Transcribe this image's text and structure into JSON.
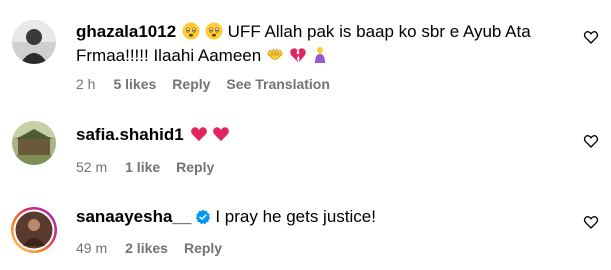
{
  "comments": [
    {
      "username": "ghazala1012",
      "text_line1": "UFF Allah pak is baap ko sbr e Ayub Ata",
      "text_line2": "Frmaa!!!!! Ilaahi Aameen",
      "time": "2 h",
      "likes": "5 likes",
      "reply": "Reply",
      "see_translation": "See Translation"
    },
    {
      "username": "safia.shahid1",
      "time": "52 m",
      "likes": "1 like",
      "reply": "Reply"
    },
    {
      "username": "sanaayesha__",
      "text": "I pray he gets justice!",
      "time": "49 m",
      "likes": "2 likes",
      "reply": "Reply"
    }
  ],
  "icons": {
    "like": "heart-outline-icon",
    "verified": "verified-badge-icon"
  },
  "colors": {
    "meta_text": "#737373",
    "verified_blue": "#0095f6",
    "heart_red": "#e0245e"
  }
}
